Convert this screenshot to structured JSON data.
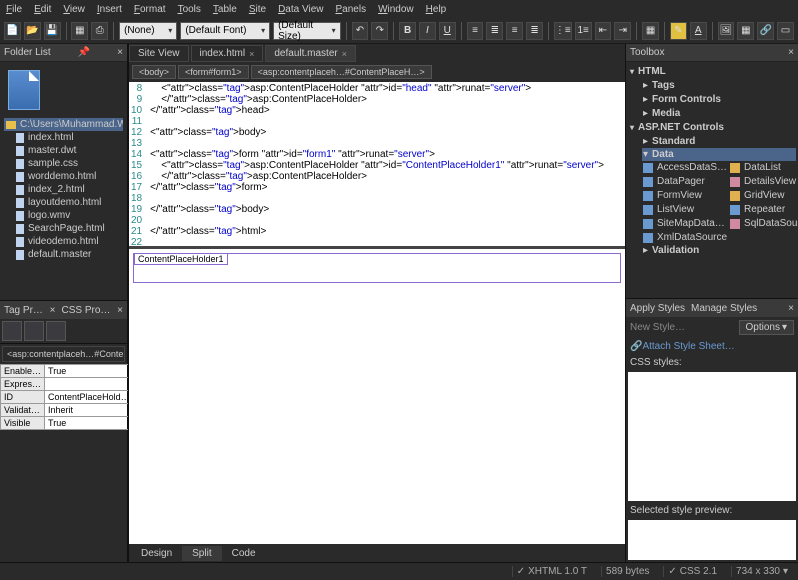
{
  "menu": [
    "File",
    "Edit",
    "View",
    "Insert",
    "Format",
    "Tools",
    "Table",
    "Site",
    "Data View",
    "Panels",
    "Window",
    "Help"
  ],
  "toolbar": {
    "style_sel": "(None)",
    "font_sel": "(Default Font)",
    "size_sel": "(Default Size)"
  },
  "folder_list": {
    "title": "Folder List",
    "root": "C:\\Users\\Muhammad.Waqas\\Do",
    "items": [
      "index.html",
      "master.dwt",
      "sample.css",
      "worddemo.html",
      "index_2.html",
      "layoutdemo.html",
      "logo.wmv",
      "SearchPage.html",
      "videodemo.html",
      "default.master"
    ]
  },
  "doc_tabs": [
    "Site View",
    "index.html",
    "default.master"
  ],
  "active_doc_tab": 2,
  "crumbs": [
    "<body>",
    "<form#form1>",
    "<asp:contentplaceh…#ContentPlaceH…>"
  ],
  "code": {
    "start": 8,
    "lines": [
      "    <asp:ContentPlaceHolder id=\"head\" runat=\"server\">",
      "    </asp:ContentPlaceHolder>",
      "</head>",
      "",
      "<body>",
      "",
      "<form id=\"form1\" runat=\"server\">",
      "    <asp:ContentPlaceHolder id=\"ContentPlaceHolder1\" runat=\"server\">",
      "    </asp:ContentPlaceHolder>",
      "</form>",
      "",
      "</body>",
      "",
      "</html>",
      ""
    ]
  },
  "design": {
    "placeholder": "ContentPlaceHolder1"
  },
  "view_tabs": [
    "Design",
    "Split",
    "Code"
  ],
  "active_view": 1,
  "toolbox": {
    "title": "Toolbox",
    "groups": [
      {
        "label": "HTML",
        "open": false,
        "children": [
          "Tags",
          "Form Controls",
          "Media"
        ]
      },
      {
        "label": "ASP.NET Controls",
        "open": true,
        "children": [
          "Standard",
          "Data",
          "Validation"
        ]
      }
    ],
    "data_items": [
      [
        "AccessDataS…",
        "DataList"
      ],
      [
        "DataPager",
        "DetailsView"
      ],
      [
        "FormView",
        "GridView"
      ],
      [
        "ListView",
        "Repeater"
      ],
      [
        "SiteMapData…",
        "SqlDataSource"
      ],
      [
        "XmlDataSource",
        ""
      ]
    ]
  },
  "styles_panel": {
    "tabs": [
      "Apply Styles",
      "Manage Styles"
    ],
    "new_style": "New Style…",
    "options": "Options",
    "attach": "Attach Style Sheet…",
    "label1": "CSS styles:",
    "label2": "Selected style preview:"
  },
  "props": {
    "tab1": "Tag Pr…",
    "tab2": "CSS Pro…",
    "crumb": "<asp:contentplaceh…#Conten…",
    "rows": [
      [
        "Enable…",
        "True"
      ],
      [
        "Expres…",
        ""
      ],
      [
        "ID",
        "ContentPlaceHold…"
      ],
      [
        "Validat…",
        "Inherit"
      ],
      [
        "Visible",
        "True"
      ]
    ]
  },
  "status": {
    "xhtml": "XHTML 1.0 T",
    "bytes": "589 bytes",
    "css": "CSS 2.1",
    "dims": "734 x 330"
  }
}
